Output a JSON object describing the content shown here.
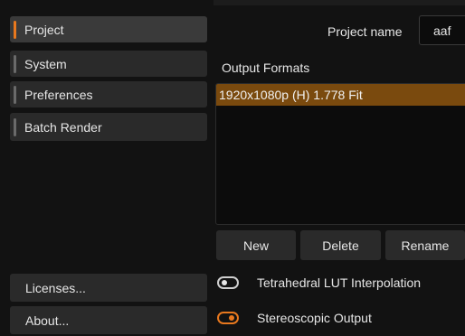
{
  "sidebar": {
    "items": [
      {
        "label": "Project"
      },
      {
        "label": "System"
      },
      {
        "label": "Preferences"
      },
      {
        "label": "Batch Render"
      }
    ],
    "footer": {
      "licenses_label": "Licenses...",
      "about_label": "About..."
    }
  },
  "project": {
    "name_label": "Project name",
    "name_value": "aaf"
  },
  "output_formats": {
    "label": "Output Formats",
    "items": [
      "1920x1080p (H) 1.778 Fit"
    ],
    "selected_index": 0
  },
  "actions": {
    "new_label": "New",
    "delete_label": "Delete",
    "rename_label": "Rename"
  },
  "options": {
    "tetrahedral": {
      "label": "Tetrahedral LUT Interpolation",
      "enabled": false
    },
    "stereoscopic": {
      "label": "Stereoscopic Output",
      "enabled": true
    }
  },
  "colors": {
    "accent": "#e8781e",
    "selection": "#7a4a0e",
    "background": "#121212",
    "button": "#2a2a2a"
  }
}
